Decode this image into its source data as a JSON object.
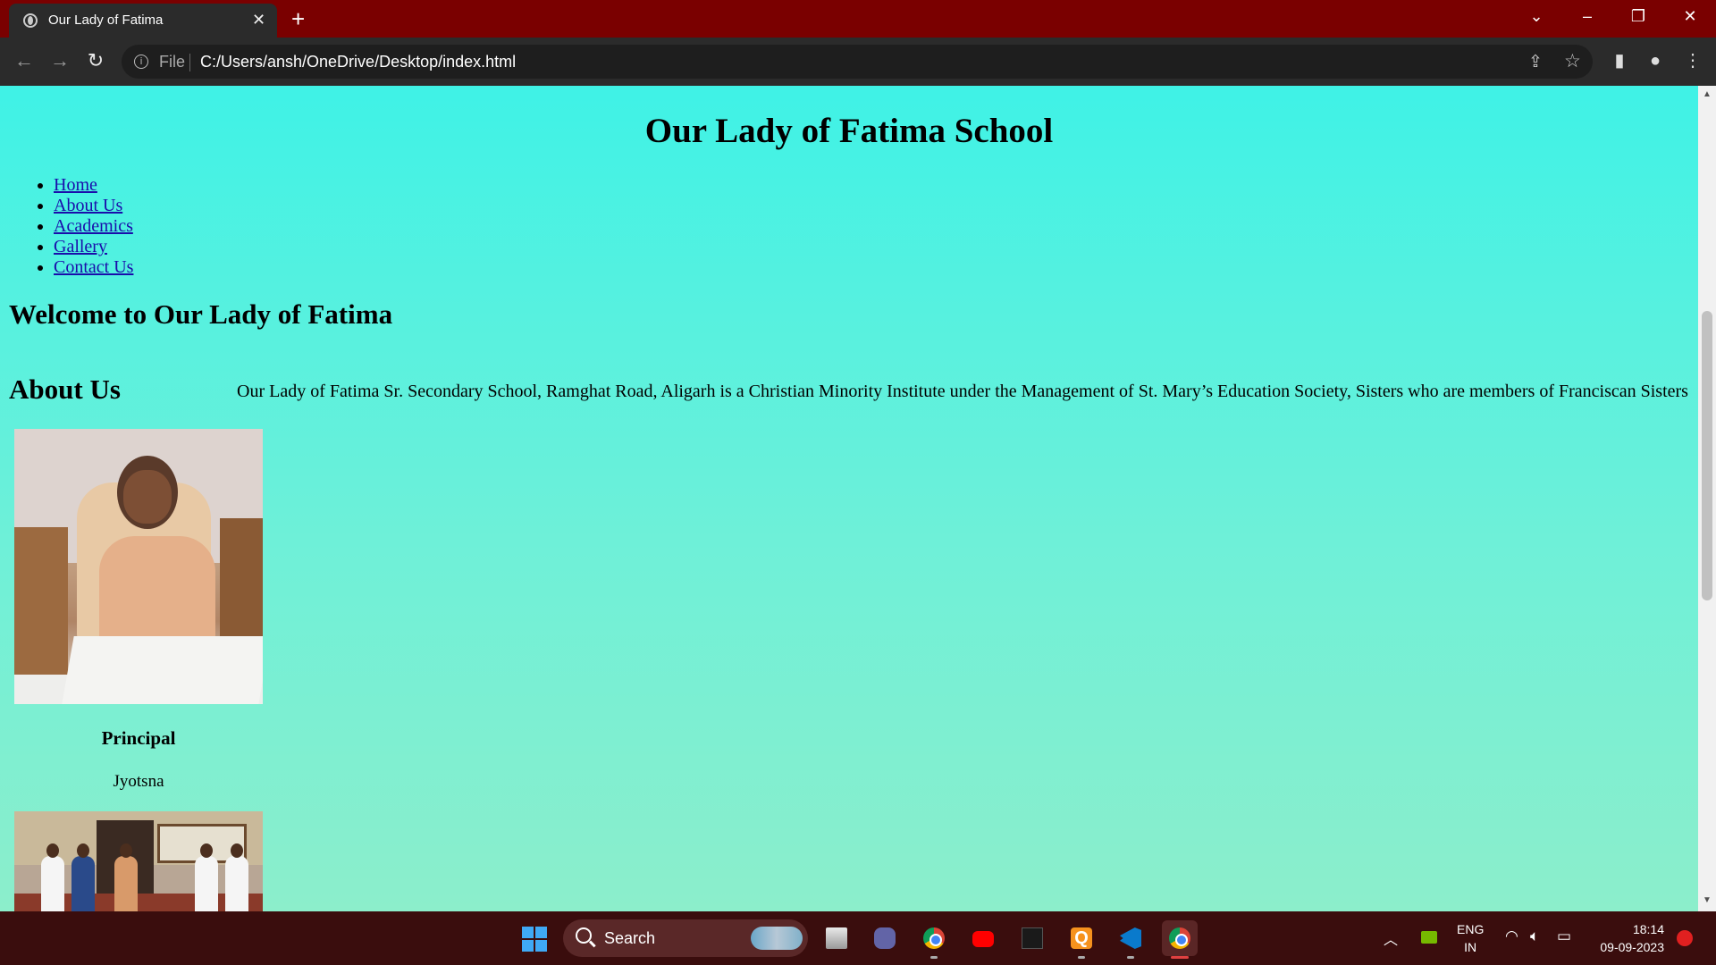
{
  "browser": {
    "tab_title": "Our Lady of Fatima",
    "url_scheme": "File",
    "url": "C:/Users/ansh/OneDrive/Desktop/index.html"
  },
  "page": {
    "site_title": "Our Lady of Fatima School",
    "nav": [
      "Home",
      "About Us",
      "Academics",
      "Gallery",
      "Contact Us"
    ],
    "welcome_heading": "Welcome to Our Lady of Fatima",
    "about_heading": "About Us",
    "about_text": "Our Lady of Fatima Sr. Secondary School, Ramghat Road, Aligarh is a Christian Minority Institute under the Management of St. Mary’s Education Society, Sisters who are members of Franciscan Sisters",
    "principal_title": "Principal",
    "principal_name": "Jyotsna",
    "background_top": "#3ff2e6",
    "background_bottom": "#8ceecb"
  },
  "taskbar": {
    "search_label": "Search",
    "lang_line1": "ENG",
    "lang_line2": "IN",
    "time": "18:14",
    "date": "09-09-2023",
    "accent": "#3a0d0d",
    "apps": [
      "file-explorer-icon",
      "teams-icon",
      "chrome-icon",
      "youtube-icon",
      "predator-icon",
      "q-app-icon",
      "vscode-icon",
      "chrome-icon"
    ]
  },
  "theme": {
    "titlebar": "#7a0000",
    "toolbar": "#2b2b2b",
    "link": "#1a0dab"
  }
}
